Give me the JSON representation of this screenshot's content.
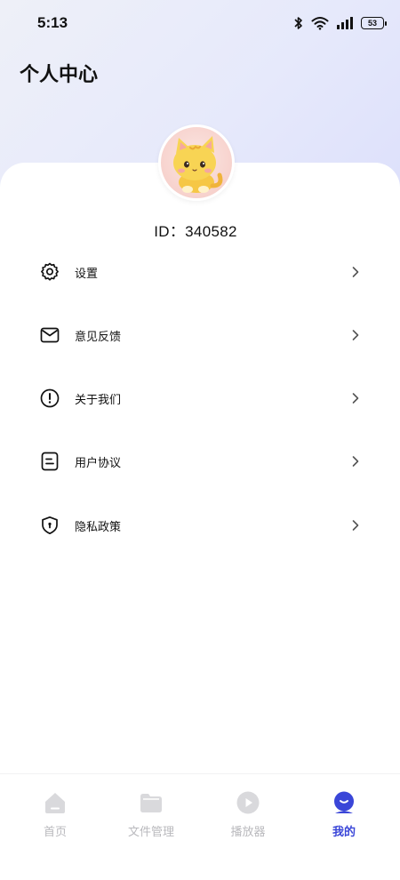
{
  "status_bar": {
    "time": "5:13",
    "battery": "53"
  },
  "header": {
    "title": "个人中心"
  },
  "profile": {
    "id_text": "ID：340582"
  },
  "menu": {
    "items": [
      {
        "label": "设置",
        "icon": "gear-icon"
      },
      {
        "label": "意见反馈",
        "icon": "mail-icon"
      },
      {
        "label": "关于我们",
        "icon": "info-icon"
      },
      {
        "label": "用户协议",
        "icon": "document-icon"
      },
      {
        "label": "隐私政策",
        "icon": "shield-icon"
      }
    ]
  },
  "tabbar": {
    "tabs": [
      {
        "label": "首页",
        "icon": "home-icon",
        "active": false
      },
      {
        "label": "文件管理",
        "icon": "folder-icon",
        "active": false
      },
      {
        "label": "播放器",
        "icon": "play-icon",
        "active": false
      },
      {
        "label": "我的",
        "icon": "profile-icon",
        "active": true
      }
    ]
  },
  "colors": {
    "accent": "#3a46d8",
    "inactive": "#b9b9bd",
    "background_top": "#e6e9fb"
  }
}
